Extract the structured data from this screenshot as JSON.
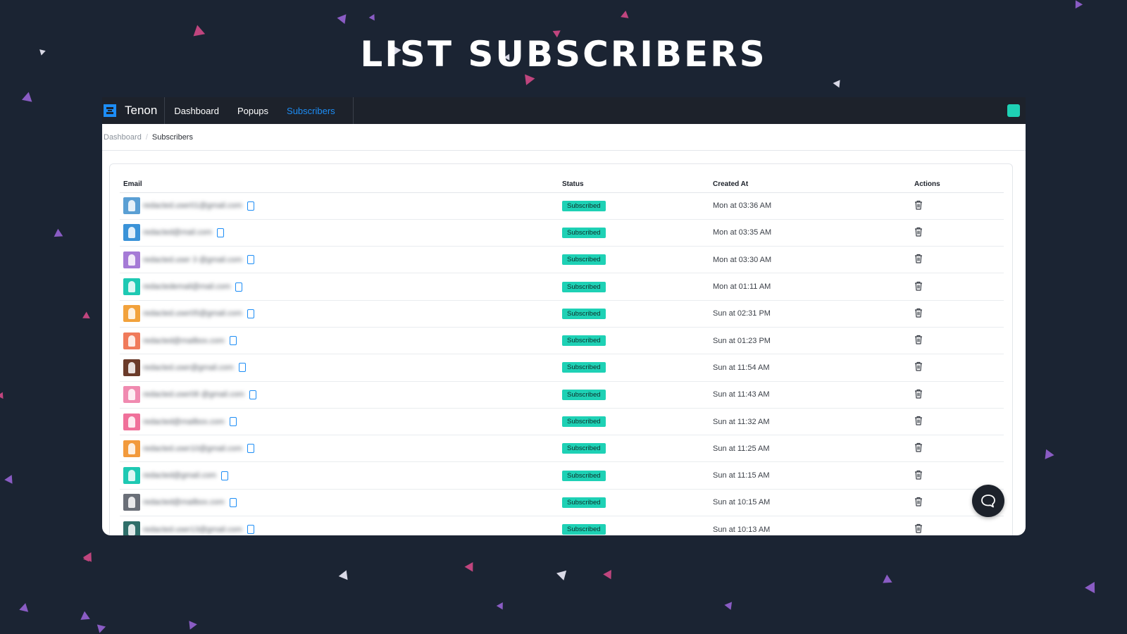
{
  "hero": {
    "title": "LIST SUBSCRIBERS"
  },
  "app": {
    "brand": {
      "name": "Tenon",
      "logo_icon": "tenon-logo-icon",
      "accent": "#1d8df5"
    },
    "nav": {
      "items": [
        {
          "label": "Dashboard",
          "active": false
        },
        {
          "label": "Popups",
          "active": false
        },
        {
          "label": "Subscribers",
          "active": true
        }
      ],
      "status_color": "#1ed1b5"
    },
    "breadcrumb": {
      "parent": "Dashboard",
      "current": "Subscribers"
    },
    "table": {
      "headers": {
        "email": "Email",
        "status": "Status",
        "created": "Created At",
        "actions": "Actions"
      },
      "rows": [
        {
          "email": "redacted.user01@gmail.com",
          "avatar": "#5a9fd4",
          "status": "Subscribed",
          "created": "Mon at 03:36 AM"
        },
        {
          "email": "redacted@mail.com",
          "avatar": "#3a93d8",
          "status": "Subscribed",
          "created": "Mon at 03:35 AM"
        },
        {
          "email": "redacted.user 3 @gmail.com",
          "avatar": "#a57ad6",
          "status": "Subscribed",
          "created": "Mon at 03:30 AM"
        },
        {
          "email": "redactedemail@mail.com",
          "avatar": "#1ec9b3",
          "status": "Subscribed",
          "created": "Mon at 01:11 AM"
        },
        {
          "email": "redacted.user05@gmail.com",
          "avatar": "#f2a23c",
          "status": "Subscribed",
          "created": "Sun at 02:31 PM"
        },
        {
          "email": "redacted@mailbox.com",
          "avatar": "#f07a5a",
          "status": "Subscribed",
          "created": "Sun at 01:23 PM"
        },
        {
          "email": "redacted.user@gmail.com",
          "avatar": "#6b3b2a",
          "status": "Subscribed",
          "created": "Sun at 11:54 AM"
        },
        {
          "email": "redacted.user08 @gmail.com",
          "avatar": "#f08ab0",
          "status": "Subscribed",
          "created": "Sun at 11:43 AM"
        },
        {
          "email": "redacted@mailbox.com",
          "avatar": "#f0709a",
          "status": "Subscribed",
          "created": "Sun at 11:32 AM"
        },
        {
          "email": "redacted.user10@gmail.com",
          "avatar": "#f29a3c",
          "status": "Subscribed",
          "created": "Sun at 11:25 AM"
        },
        {
          "email": "redacted@gmail.com",
          "avatar": "#1ec9b3",
          "status": "Subscribed",
          "created": "Sun at 11:15 AM"
        },
        {
          "email": "redacted@mailbox.com",
          "avatar": "#6a6f78",
          "status": "Subscribed",
          "created": "Sun at 10:15 AM"
        },
        {
          "email": "redacted.user13@gmail.com",
          "avatar": "#2f6f6a",
          "status": "Subscribed",
          "created": "Sun at 10:13 AM"
        }
      ]
    },
    "icons": {
      "copy": "copy-icon",
      "delete": "trash-icon",
      "chat": "chat-bubble-icon"
    },
    "colors": {
      "badge": "#1ed1b5",
      "background": "#1b2433",
      "confetti": "#c0457e",
      "confetti_alt": "#8a5cc4"
    }
  }
}
